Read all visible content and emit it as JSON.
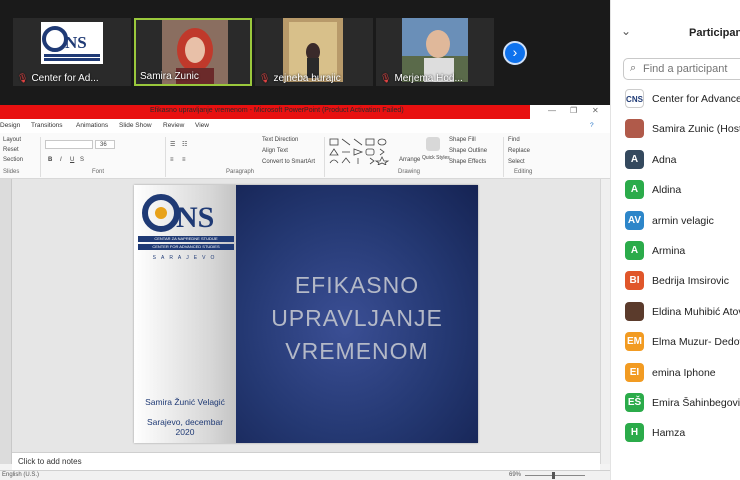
{
  "gallery": {
    "tiles": [
      {
        "name": "Center for Ad..."
      },
      {
        "name": "Samira Zunic"
      },
      {
        "name": "zejneba burajic"
      },
      {
        "name": "Merjema Hod..."
      }
    ],
    "next_icon": "chevron-right-icon"
  },
  "participants": {
    "title": "Participant",
    "search_placeholder": "Find a participant",
    "list": [
      {
        "initials": "CNS",
        "name": "Center for Advanced",
        "color": "#ffffff"
      },
      {
        "initials": "",
        "name": "Samira Zunic (Host)",
        "color": "#b05a4a"
      },
      {
        "initials": "A",
        "name": "Adna",
        "color": "#34495e"
      },
      {
        "initials": "A",
        "name": "Aldina",
        "color": "#2bab4a"
      },
      {
        "initials": "AV",
        "name": "armin velagic",
        "color": "#2d86c9"
      },
      {
        "initials": "A",
        "name": "Armina",
        "color": "#2bab4a"
      },
      {
        "initials": "BI",
        "name": "Bedrija Imsirovic",
        "color": "#e0562a"
      },
      {
        "initials": "",
        "name": "Eldina Muhibić Atovi",
        "color": "#5b3b2c"
      },
      {
        "initials": "EM",
        "name": "Elma Muzur- Dedovi",
        "color": "#f29b22"
      },
      {
        "initials": "EI",
        "name": "emina Iphone",
        "color": "#f29b22"
      },
      {
        "initials": "EŠ",
        "name": "Emira Šahinbegović",
        "color": "#2bab4a"
      },
      {
        "initials": "H",
        "name": "Hamza",
        "color": "#2bab4a"
      }
    ]
  },
  "ppt": {
    "title": "Efikasno upravljanje vremenom - Microsoft PowerPoint (Product Activation Failed)",
    "tabs": [
      "Design",
      "Transitions",
      "Animations",
      "Slide Show",
      "Review",
      "View"
    ],
    "groups": [
      "Slides",
      "Font",
      "Paragraph",
      "Drawing",
      "Editing"
    ],
    "ribbon": {
      "layout": "Layout",
      "reset": "Reset",
      "section": "Section",
      "font_size": "36",
      "text_direction": "Text Direction",
      "align_text": "Align Text",
      "convert_smartart": "Convert to SmartArt",
      "arrange": "Arrange",
      "quick_styles": "Quick Styles",
      "shape_fill": "Shape Fill",
      "shape_outline": "Shape Outline",
      "shape_effects": "Shape Effects",
      "find": "Find",
      "replace": "Replace",
      "select": "Select"
    },
    "slide": {
      "logo": "CNS",
      "logo_line1": "CENTAR ZA NAPREDNE STUDIJE",
      "logo_line2": "CENTER FOR ADVANCED STUDIES",
      "logo_city": "SARAJEVO",
      "title_line1": "EFIKASNO",
      "title_line2": "UPRAVLJANJE",
      "title_line3": "VREMENOM",
      "author": "Samira Žunić Velagić",
      "place_line1": "Sarajevo, decembar",
      "place_line2": "2020"
    },
    "notes_placeholder": "Click to add notes",
    "status_language": "English (U.S.)",
    "zoom": "69%"
  }
}
